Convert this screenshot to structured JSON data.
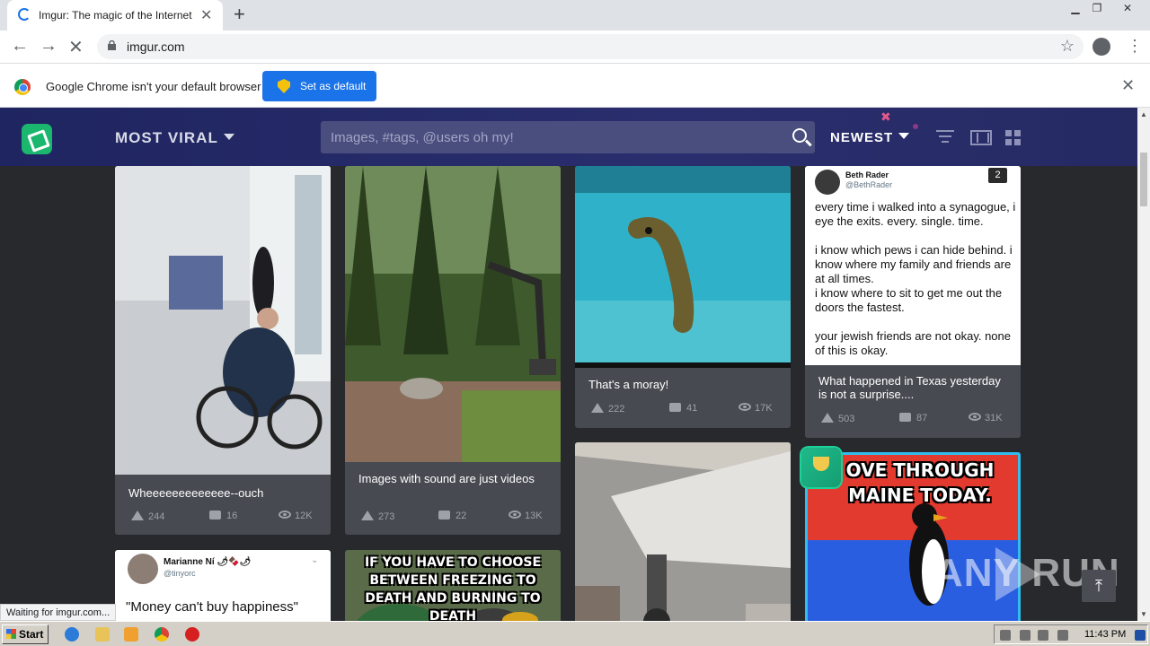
{
  "browser": {
    "tab_title": "Imgur: The magic of the Internet",
    "new_tab_symbol": "+",
    "url": "imgur.com",
    "infobar_message": "Google Chrome isn't your default browser",
    "set_default_label": "Set as default",
    "status_text": "Waiting for imgur.com..."
  },
  "imgur": {
    "section_label": "MOST VIRAL",
    "search_placeholder": "Images, #tags, @users oh my!",
    "sort_label": "NEWEST"
  },
  "posts": [
    {
      "title": "Wheeeeeeeeeeeee--ouch",
      "points": "244",
      "comments": "16",
      "views": "12K"
    },
    {
      "title": "Images with sound are just videos",
      "points": "273",
      "comments": "22",
      "views": "13K"
    },
    {
      "title": "That's a moray!",
      "points": "222",
      "comments": "41",
      "views": "17K"
    },
    {
      "title": "What happened in Texas yesterday is not a surprise....",
      "points": "503",
      "comments": "87",
      "views": "31K"
    }
  ],
  "tweet1": {
    "name": "Beth Rader",
    "handle": "@BethRader",
    "badge": "2",
    "text": "every time i walked into a synagogue, i eye the exits. every. single. time.\n\ni know which pews i can hide behind. i know where my family and friends are at all times.\ni know where to sit to get me out the doors the fastest.\n\nyour jewish friends are not okay. none of this is okay."
  },
  "tweet2": {
    "name": "Marianne Ní 🌶🍫🌶",
    "handle": "@tinyorc",
    "text": "\"Money can't buy happiness\""
  },
  "meme1": {
    "text": "IF YOU HAVE TO CHOOSE BETWEEN FREEZING TO DEATH AND BURNING TO DEATH"
  },
  "meme2": {
    "text": "OVE THROUGH MAINE TODAY."
  },
  "watermark": "ANY RUN",
  "taskbar": {
    "start_label": "Start",
    "clock": "11:43 PM"
  }
}
